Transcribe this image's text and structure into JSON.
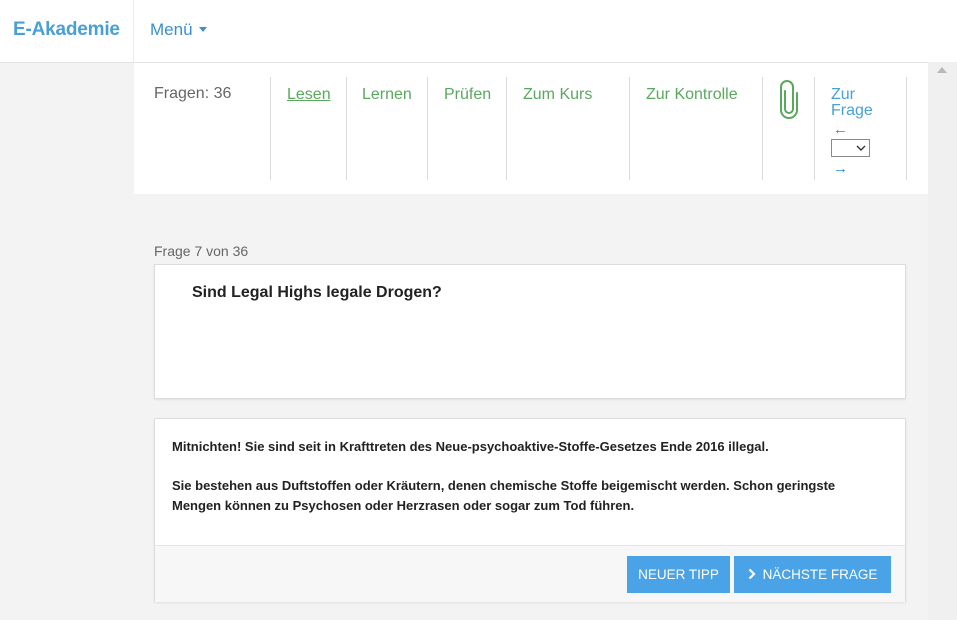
{
  "navbar": {
    "brand": "E-Akademie",
    "menu_label": "Menü"
  },
  "toolbar": {
    "count_label": "Fragen: 36",
    "links": [
      {
        "label": "Lesen",
        "active": true
      },
      {
        "label": "Lernen",
        "active": false
      },
      {
        "label": "Prüfen",
        "active": false
      },
      {
        "label": "Zum Kurs",
        "active": false
      },
      {
        "label": "Zur Kontrolle",
        "active": false
      }
    ],
    "attachment_icon": "paperclip-icon",
    "goto": {
      "label_line1": "Zur",
      "label_line2": "Frage",
      "prev_arrow": "←",
      "next_arrow": "→",
      "selected_value": ""
    }
  },
  "question": {
    "progress": "Frage 7 von 36",
    "text": "Sind Legal Highs legale Drogen?"
  },
  "answer": {
    "paragraph1": "Mitnichten! Sie sind seit in Krafttreten des Neue-psychoaktive-Stoffe-Gesetzes Ende 2016 illegal.",
    "paragraph2": "Sie bestehen aus Duftstoffen oder Kräutern, denen chemische Stoffe beigemischt werden. Schon geringste Mengen können zu Psychosen oder Herzrasen oder sogar zum Tod führen."
  },
  "buttons": {
    "tip_label": "NEUER TIPP",
    "next_label": "NÄCHSTE FRAGE"
  },
  "colors": {
    "brand": "#4a9fd5",
    "link_green": "#5aa85e",
    "button_blue": "#4aa3e6",
    "background": "#f3f3f3"
  }
}
